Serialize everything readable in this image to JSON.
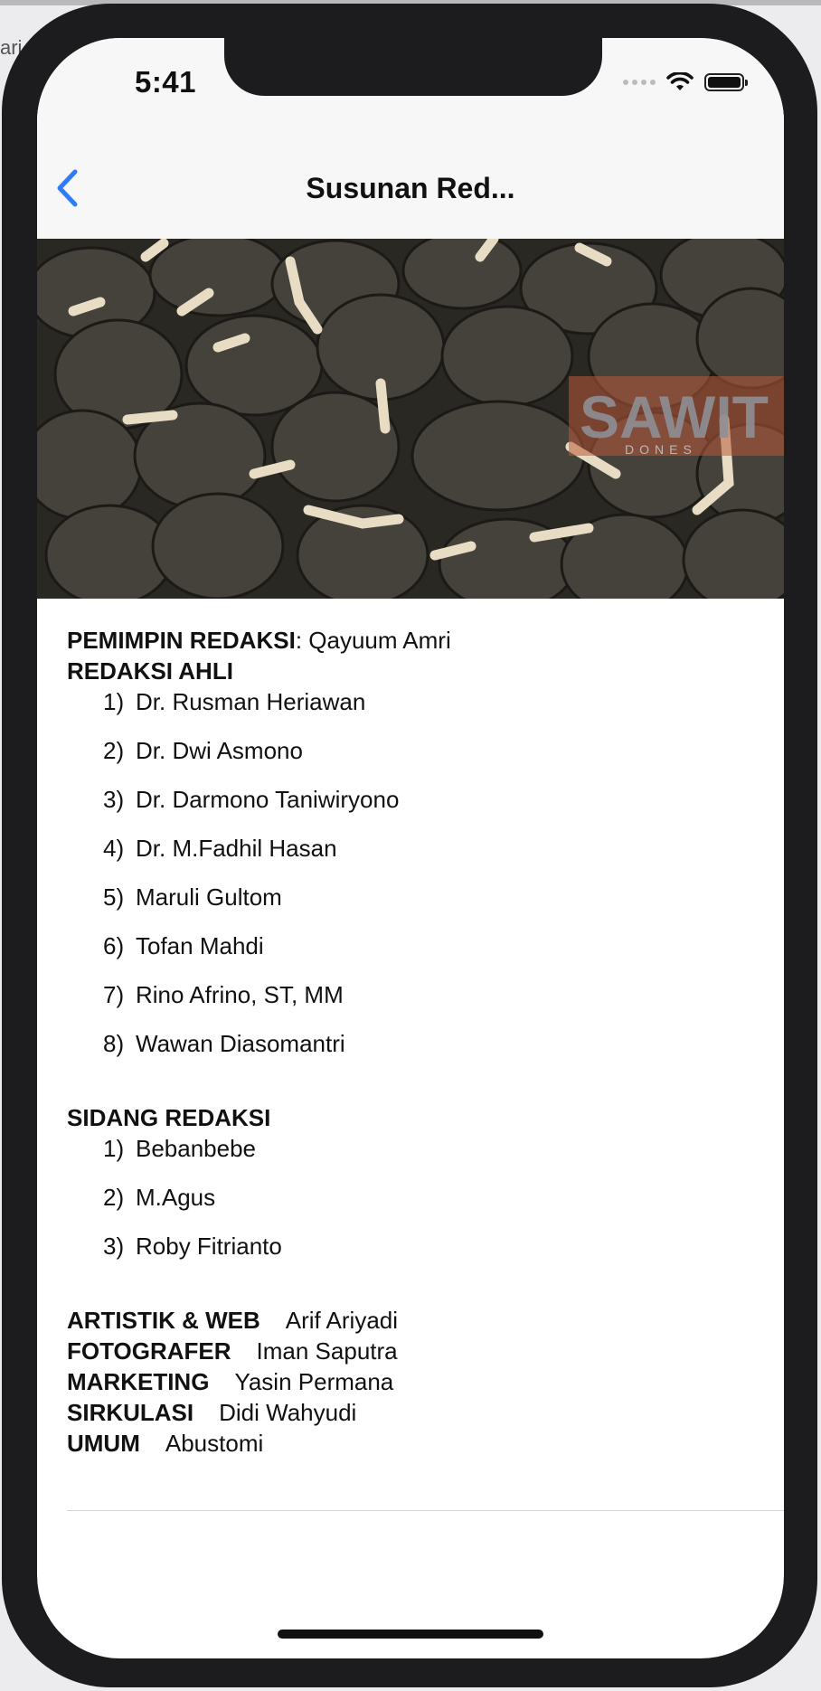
{
  "background": {
    "left_text": "ari"
  },
  "status_bar": {
    "time": "5:41"
  },
  "nav": {
    "title": "Susunan Red...",
    "back_icon": "chevron-left-icon"
  },
  "hero": {
    "watermark": "SAWIT",
    "watermark_sub": "DONES"
  },
  "content": {
    "pemimpin": {
      "label": "PEMIMPIN REDAKSI",
      "value": ": Qayuum Amri"
    },
    "redaksi_ahli": {
      "heading": "REDAKSI AHLI",
      "items": [
        {
          "num": "1)",
          "name": "Dr. Rusman Heriawan"
        },
        {
          "num": "2)",
          "name": "Dr. Dwi Asmono"
        },
        {
          "num": "3)",
          "name": "Dr. Darmono Taniwiryono"
        },
        {
          "num": "4)",
          "name": "Dr. M.Fadhil Hasan"
        },
        {
          "num": "5)",
          "name": "Maruli Gultom"
        },
        {
          "num": "6)",
          "name": "Tofan Mahdi"
        },
        {
          "num": "7)",
          "name": "Rino Afrino, ST, MM"
        },
        {
          "num": "8)",
          "name": "Wawan Diasomantri"
        }
      ]
    },
    "sidang_redaksi": {
      "heading": "SIDANG REDAKSI",
      "items": [
        {
          "num": "1)",
          "name": "Bebanbebe"
        },
        {
          "num": "2)",
          "name": "M.Agus"
        },
        {
          "num": "3)",
          "name": "Roby Fitrianto"
        }
      ]
    },
    "roles": [
      {
        "label": "ARTISTIK & WEB",
        "value": "Arif Ariyadi"
      },
      {
        "label": "FOTOGRAFER",
        "value": "Iman Saputra"
      },
      {
        "label": "MARKETING",
        "value": "Yasin Permana"
      },
      {
        "label": "SIRKULASI",
        "value": "Didi Wahyudi"
      },
      {
        "label": "UMUM",
        "value": "Abustomi"
      }
    ]
  },
  "colors": {
    "accent": "#2f7cf6",
    "nav_bg": "#f7f7f7",
    "text": "#111111"
  }
}
